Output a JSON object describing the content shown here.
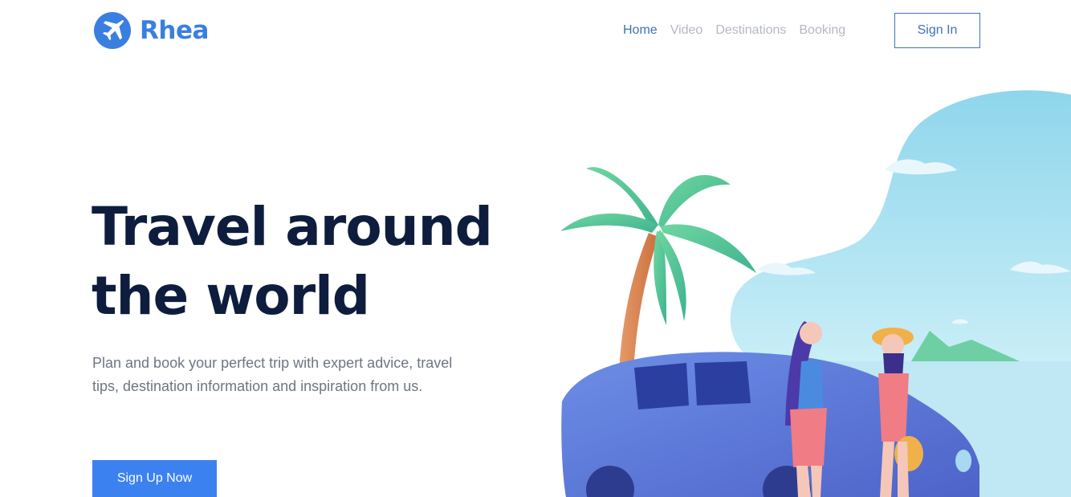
{
  "brand": {
    "name": "Rhea",
    "icon": "airplane-icon",
    "color": "#3a7fe0"
  },
  "nav": {
    "items": [
      {
        "label": "Home",
        "active": true
      },
      {
        "label": "Video",
        "active": false
      },
      {
        "label": "Destinations",
        "active": false
      },
      {
        "label": "Booking",
        "active": false
      }
    ],
    "sign_in_label": "Sign In"
  },
  "hero": {
    "title_line1": "Travel around",
    "title_line2": "the world",
    "description": "Plan and book your perfect trip with expert advice, travel tips, destination information and inspiration from us.",
    "cta_label": "Sign Up Now"
  },
  "colors": {
    "accent": "#3b82f0",
    "heading": "#0e1d3d",
    "nav_active": "#3f72b5",
    "nav_inactive": "#b4b8bf"
  }
}
